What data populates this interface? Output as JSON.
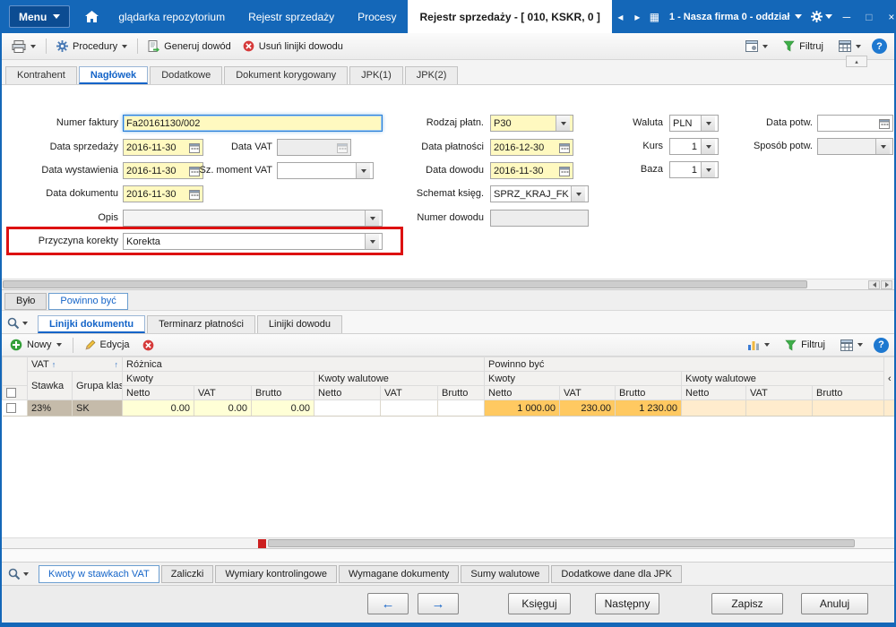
{
  "titlebar": {
    "menu": "Menu",
    "tab1": "glądarka repozytorium",
    "tab2": "Rejestr sprzedaży",
    "tab3": "Procesy",
    "active_tab": "Rejestr sprzedaży - [ 010, KSKR, 0 ]",
    "company": "1 - Nasza firma 0 - oddział"
  },
  "icons": {
    "minimize": "─",
    "maximize": "□",
    "close": "×",
    "nav_left": "◂",
    "nav_right": "▸",
    "apps": "▦",
    "help": "?",
    "collapse_up": "▴",
    "collapse_left": "‹",
    "arrow_left": "←",
    "arrow_right": "→",
    "sort_asc": "↑"
  },
  "toolbar": {
    "procedury": "Procedury",
    "generuj_dowod": "Generuj dowód",
    "usun_linijki": "Usuń linijki dowodu",
    "filtruj": "Filtruj"
  },
  "form_tabs": {
    "kontrahent": "Kontrahent",
    "naglowek": "Nagłówek",
    "dodatkowe": "Dodatkowe",
    "dokument_korygowany": "Dokument korygowany",
    "jpk1": "JPK(1)",
    "jpk2": "JPK(2)"
  },
  "form": {
    "numer_faktury": {
      "label": "Numer faktury",
      "value": "Fa20161130/002"
    },
    "data_sprzedazy": {
      "label": "Data sprzedaży",
      "value": "2016-11-30"
    },
    "data_vat": {
      "label": "Data VAT",
      "value": ""
    },
    "data_wystawienia": {
      "label": "Data wystawienia",
      "value": "2016-11-30"
    },
    "sz_moment_vat": {
      "label": "Sz. moment VAT",
      "value": ""
    },
    "data_dokumentu": {
      "label": "Data dokumentu",
      "value": "2016-11-30"
    },
    "opis": {
      "label": "Opis",
      "value": ""
    },
    "przyczyna_korekty": {
      "label": "Przyczyna korekty",
      "value": "Korekta"
    },
    "rodzaj_platn": {
      "label": "Rodzaj płatn.",
      "value": "P30"
    },
    "data_platnosci": {
      "label": "Data płatności",
      "value": "2016-12-30"
    },
    "data_dowodu": {
      "label": "Data dowodu",
      "value": "2016-11-30"
    },
    "schemat_ksieg": {
      "label": "Schemat księg.",
      "value": "SPRZ_KRAJ_FK"
    },
    "numer_dowodu": {
      "label": "Numer dowodu",
      "value": ""
    },
    "waluta": {
      "label": "Waluta",
      "value": "PLN"
    },
    "kurs": {
      "label": "Kurs",
      "value": "1"
    },
    "baza": {
      "label": "Baza",
      "value": "1"
    },
    "data_potw": {
      "label": "Data potw.",
      "value": ""
    },
    "sposob_potw": {
      "label": "Sposób potw.",
      "value": ""
    }
  },
  "panel_tabs": {
    "bylo": "Było",
    "powinno_byc": "Powinno być"
  },
  "grid": {
    "view_tabs": {
      "linijki_dokumentu": "Linijki dokumentu",
      "terminarz_platnosci": "Terminarz płatności",
      "linijki_dowodu": "Linijki dowodu"
    },
    "toolbar": {
      "nowy": "Nowy",
      "edycja": "Edycja",
      "filtruj": "Filtruj"
    },
    "header": {
      "vat_group": "VAT",
      "roznica": "Różnica",
      "powinno_byc": "Powinno być",
      "stawka": "Stawka",
      "grupa_klas": "Grupa klas.",
      "kwoty": "Kwoty",
      "kwoty_walutowe": "Kwoty walutowe",
      "netto": "Netto",
      "vat": "VAT",
      "brutto": "Brutto"
    },
    "rows": [
      {
        "stawka": "23%",
        "grupa_klas": "SK",
        "r_netto": "0.00",
        "r_vat": "0.00",
        "r_brutto": "0.00",
        "rw_netto": "",
        "rw_vat": "",
        "rw_brutto": "",
        "p_netto": "1 000.00",
        "p_vat": "230.00",
        "p_brutto": "1 230.00",
        "pw_netto": "",
        "pw_vat": "",
        "pw_brutto": ""
      }
    ]
  },
  "bottom_tabs": {
    "kwoty_w_stawkach": "Kwoty w stawkach VAT",
    "zaliczki": "Zaliczki",
    "wymiary": "Wymiary kontrolingowe",
    "wymagane": "Wymagane dokumenty",
    "sumy_walutowe": "Sumy walutowe",
    "dodatkowe_jpk": "Dodatkowe dane dla JPK"
  },
  "footer": {
    "ksieguj": "Księguj",
    "nastepny": "Następny",
    "zapisz": "Zapisz",
    "anuluj": "Anuluj"
  }
}
